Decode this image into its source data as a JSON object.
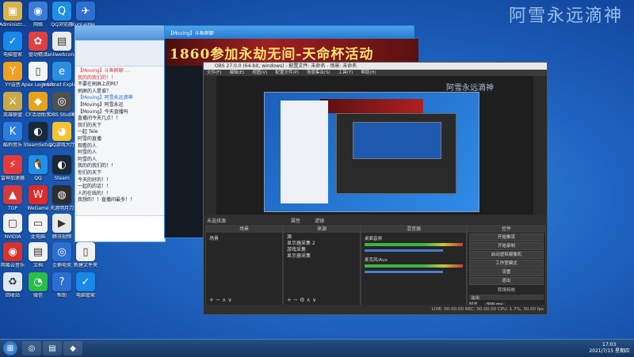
{
  "watermark": "阿雪永远滴神",
  "desktop_icons": [
    {
      "label": "Administr...",
      "color": "#d9b24a",
      "glyph": "▣"
    },
    {
      "label": "网络",
      "color": "#3a7bd5",
      "glyph": "◉"
    },
    {
      "label": "QQ浏览器",
      "color": "#1e8fe6",
      "glyph": "Q"
    },
    {
      "label": "XunLeiWe...",
      "color": "#2e6fd2",
      "glyph": "✈"
    },
    {
      "label": "电脑管家",
      "color": "#1a88e8",
      "glyph": "✓"
    },
    {
      "label": "驱动精灵",
      "color": "#e23f3f",
      "glyph": "✿"
    },
    {
      "label": "fanliwebcon...",
      "color": "#eaeaea",
      "glyph": "▤"
    },
    {
      "label": "QQ游戏",
      "color": "#f3c129",
      "glyph": "◕"
    },
    {
      "label": "YY语音",
      "color": "#f0a020",
      "glyph": "Y"
    },
    {
      "label": "Apex Legends",
      "color": "#f4f4f4",
      "glyph": "▯"
    },
    {
      "label": "Internet Explorer",
      "color": "#2b8fe0",
      "glyph": "e"
    },
    {
      "label": "Office",
      "color": "#e86b1f",
      "glyph": "◼"
    },
    {
      "label": "英雄联盟",
      "color": "#c8a94a",
      "glyph": "⚔"
    },
    {
      "label": "CF活动助手",
      "color": "#e8a21c",
      "glyph": "◆"
    },
    {
      "label": "OBS Studio",
      "color": "#505050",
      "glyph": "◎"
    },
    {
      "label": "地下城与勇士",
      "color": "#e8c33a",
      "glyph": "◈"
    },
    {
      "label": "酷狗音乐",
      "color": "#2b7de0",
      "glyph": "K"
    },
    {
      "label": "SteamSetup",
      "color": "#1b2838",
      "glyph": "◐"
    },
    {
      "label": "QQ游戏大厅",
      "color": "#f5c230",
      "glyph": "◕"
    },
    {
      "label": "QQ音乐",
      "color": "#2dbe60",
      "glyph": "♫"
    },
    {
      "label": "雷神加速器",
      "color": "#e33a3a",
      "glyph": "⚡"
    },
    {
      "label": "QQ",
      "color": "#1e90e8",
      "glyph": "🐧"
    },
    {
      "label": "Steam",
      "color": "#1b2838",
      "glyph": "◐"
    },
    {
      "label": "腾讯QQ",
      "color": "#1e8fe6",
      "glyph": "Q"
    },
    {
      "label": "TGP",
      "color": "#d33a3a",
      "glyph": "▲"
    },
    {
      "label": "WeGame",
      "color": "#e02a2a",
      "glyph": "W"
    },
    {
      "label": "天涯明月刀",
      "color": "#2d2d2d",
      "glyph": "◍"
    },
    {
      "label": "迅雷",
      "color": "#3b84e0",
      "glyph": "e"
    },
    {
      "label": "NVIDIA",
      "color": "#f0f0f0",
      "glyph": "▢"
    },
    {
      "label": "此电脑",
      "color": "#f5f5f5",
      "glyph": "▭"
    },
    {
      "label": "腾讯视频",
      "color": "#e8e8e8",
      "glyph": "▶"
    },
    {
      "label": "文件夹",
      "color": "#f4c04a",
      "glyph": "▰"
    },
    {
      "label": "网易云音乐",
      "color": "#d8322c",
      "glyph": "◉"
    },
    {
      "label": "文档",
      "color": "#f2f2f2",
      "glyph": "▤"
    },
    {
      "label": "企鹅电竞",
      "color": "#2b6fd0",
      "glyph": "◎"
    },
    {
      "label": "新建文件夹",
      "color": "#f2f2f2",
      "glyph": "▯"
    },
    {
      "label": "回收站",
      "color": "#dfe8f5",
      "glyph": "♻"
    },
    {
      "label": "微信",
      "color": "#2bbd4a",
      "glyph": "◔"
    },
    {
      "label": "帮助",
      "color": "#2b6fd0",
      "glyph": "?"
    },
    {
      "label": "电脑管家",
      "color": "#1a88e8",
      "glyph": "✓"
    }
  ],
  "chat": {
    "title": "【Moving】斗鱼群聊",
    "messages": [
      {
        "text": "【Moving】斗鱼群聊 ...",
        "cls": "red"
      },
      {
        "text": "我的的我们的！！",
        "cls": "red"
      },
      {
        "text": "不要在刷屏上的吗？",
        "cls": ""
      },
      {
        "text": "刷屏的人是谁？",
        "cls": ""
      },
      {
        "text": "【Moving】阿雪永远滴神",
        "cls": "blue"
      },
      {
        "text": "【Moving】阿雪永远",
        "cls": ""
      },
      {
        "text": "【Moving】今天直播吗",
        "cls": ""
      },
      {
        "text": "直播间今天几点！！",
        "cls": ""
      },
      {
        "text": "我们的天下",
        "cls": ""
      },
      {
        "text": "一起  Tele",
        "cls": ""
      },
      {
        "text": "阿雪的直播",
        "cls": ""
      },
      {
        "text": "观看的人",
        "cls": ""
      },
      {
        "text": "阿雪的人",
        "cls": ""
      },
      {
        "text": "阿雪的人",
        "cls": ""
      },
      {
        "text": "我的的我们的！！",
        "cls": ""
      },
      {
        "text": "你们的天下",
        "cls": ""
      },
      {
        "text": "今天的好的！！",
        "cls": ""
      },
      {
        "text": "一起的的话！！",
        "cls": ""
      },
      {
        "text": "人的在线的！！",
        "cls": ""
      },
      {
        "text": "我想的！！直播间最多！！",
        "cls": ""
      }
    ]
  },
  "room": {
    "title": "【Moving】斗鱼群聊",
    "banner": "1860参加永劫无间-天命杯活动"
  },
  "obs": {
    "title": "OBS 27.0.0 (64-bit, windows) - 配置文件: 未命名 - 场景: 未命名",
    "menu": [
      "文件(F)",
      "编辑(E)",
      "视图(V)",
      "配置文件(P)",
      "场景集合(S)",
      "工具(T)",
      "帮助(H)"
    ],
    "scene_bar_text": "未选择源",
    "scene_bar_btns": [
      "属性",
      "滤镜"
    ],
    "docks": {
      "scenes": {
        "header": "场景",
        "items": [
          "场景"
        ]
      },
      "sources": {
        "header": "来源",
        "items": [
          "源",
          "显示器采集 2",
          "游戏采集",
          "显示器采集"
        ]
      },
      "mixer": {
        "header": "混音器",
        "tracks": [
          "桌面音频",
          "麦克风/Aux"
        ]
      },
      "controls": {
        "header": "控件",
        "buttons": [
          "开始推流",
          "开始录制",
          "启动虚拟摄像机",
          "工作室模式",
          "设置",
          "退出"
        ]
      },
      "transitions": {
        "header": "转场特效",
        "type": "淡出",
        "duration_label": "时长",
        "duration_value": "300 ms"
      }
    },
    "status": "LIVE: 00:00:00   REC: 00:00:00   CPU: 1.7%, 30.00 fps"
  },
  "taskbar": {
    "time": "17:03",
    "date": "2021/7/15 星期四"
  }
}
